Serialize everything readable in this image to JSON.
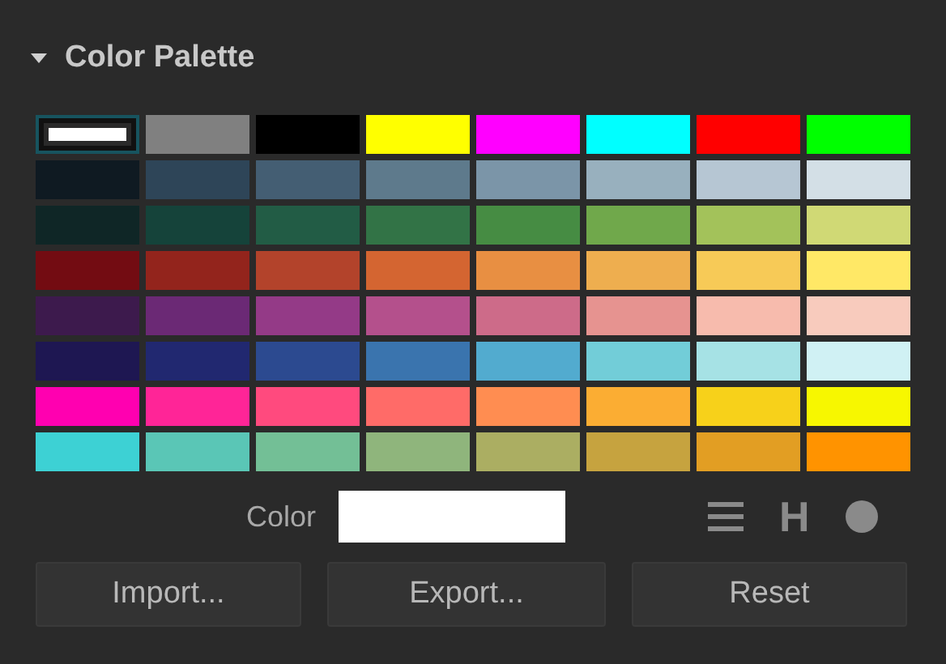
{
  "section": {
    "title": "Color Palette",
    "expanded": true
  },
  "swatches": [
    {
      "color": "#ffffff",
      "selected": true
    },
    {
      "color": "#808080",
      "selected": false
    },
    {
      "color": "#000000",
      "selected": false
    },
    {
      "color": "#ffff00",
      "selected": false
    },
    {
      "color": "#ff00ff",
      "selected": false
    },
    {
      "color": "#00ffff",
      "selected": false
    },
    {
      "color": "#ff0000",
      "selected": false
    },
    {
      "color": "#00ff00",
      "selected": false
    },
    {
      "color": "#0f1a22",
      "selected": false
    },
    {
      "color": "#2e4558",
      "selected": false
    },
    {
      "color": "#445e73",
      "selected": false
    },
    {
      "color": "#5e7a8c",
      "selected": false
    },
    {
      "color": "#7b95a8",
      "selected": false
    },
    {
      "color": "#98b0be",
      "selected": false
    },
    {
      "color": "#b6c6d3",
      "selected": false
    },
    {
      "color": "#d3dfe6",
      "selected": false
    },
    {
      "color": "#0f2626",
      "selected": false
    },
    {
      "color": "#15433a",
      "selected": false
    },
    {
      "color": "#225c45",
      "selected": false
    },
    {
      "color": "#327346",
      "selected": false
    },
    {
      "color": "#468c43",
      "selected": false
    },
    {
      "color": "#70a84b",
      "selected": false
    },
    {
      "color": "#a3c25a",
      "selected": false
    },
    {
      "color": "#d0d975",
      "selected": false
    },
    {
      "color": "#730c12",
      "selected": false
    },
    {
      "color": "#93241c",
      "selected": false
    },
    {
      "color": "#b3432b",
      "selected": false
    },
    {
      "color": "#d46531",
      "selected": false
    },
    {
      "color": "#e88f42",
      "selected": false
    },
    {
      "color": "#eeae4f",
      "selected": false
    },
    {
      "color": "#f7ca57",
      "selected": false
    },
    {
      "color": "#ffe866",
      "selected": false
    },
    {
      "color": "#3d1a4d",
      "selected": false
    },
    {
      "color": "#6b2975",
      "selected": false
    },
    {
      "color": "#943a87",
      "selected": false
    },
    {
      "color": "#b4508c",
      "selected": false
    },
    {
      "color": "#cd6b89",
      "selected": false
    },
    {
      "color": "#e69390",
      "selected": false
    },
    {
      "color": "#f7bbad",
      "selected": false
    },
    {
      "color": "#f8cbbd",
      "selected": false
    },
    {
      "color": "#1e1752",
      "selected": false
    },
    {
      "color": "#212870",
      "selected": false
    },
    {
      "color": "#2c4a90",
      "selected": false
    },
    {
      "color": "#3a74ae",
      "selected": false
    },
    {
      "color": "#52abcf",
      "selected": false
    },
    {
      "color": "#72cdd8",
      "selected": false
    },
    {
      "color": "#a6e2e5",
      "selected": false
    },
    {
      "color": "#d0f1f4",
      "selected": false
    },
    {
      "color": "#ff00b0",
      "selected": false
    },
    {
      "color": "#ff2597",
      "selected": false
    },
    {
      "color": "#ff4a7e",
      "selected": false
    },
    {
      "color": "#ff6b68",
      "selected": false
    },
    {
      "color": "#ff8d51",
      "selected": false
    },
    {
      "color": "#fbad33",
      "selected": false
    },
    {
      "color": "#f7d11a",
      "selected": false
    },
    {
      "color": "#f7f700",
      "selected": false
    },
    {
      "color": "#3dd1d4",
      "selected": false
    },
    {
      "color": "#5ac6b6",
      "selected": false
    },
    {
      "color": "#73bf96",
      "selected": false
    },
    {
      "color": "#8fb57c",
      "selected": false
    },
    {
      "color": "#abae62",
      "selected": false
    },
    {
      "color": "#c6a33f",
      "selected": false
    },
    {
      "color": "#e29e23",
      "selected": false
    },
    {
      "color": "#ff9300",
      "selected": false
    }
  ],
  "color_field": {
    "label": "Color",
    "color": "#ffffff"
  },
  "mode_buttons": [
    {
      "kind": "list"
    },
    {
      "kind": "text",
      "label": "H"
    },
    {
      "kind": "circle"
    }
  ],
  "buttons": [
    "Import...",
    "Export...",
    "Reset"
  ]
}
